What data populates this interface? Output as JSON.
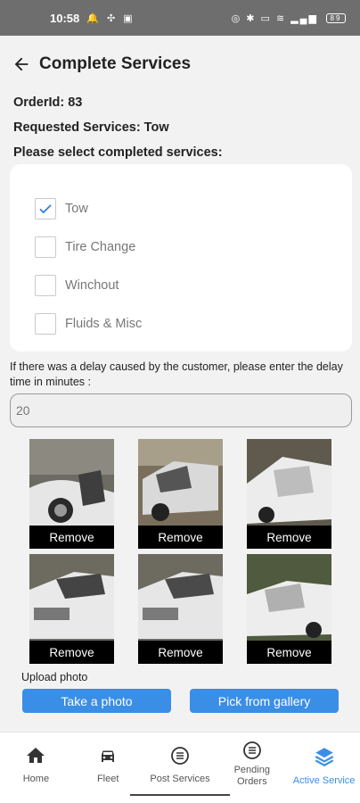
{
  "status_bar": {
    "time": "10:58",
    "battery": "89"
  },
  "header": {
    "title": "Complete Services"
  },
  "order": {
    "id_text": "OrderId: 83",
    "requested_text": "Requested Services: Tow",
    "prompt": "Please select completed services:"
  },
  "services": [
    {
      "label": "Tow",
      "checked": true
    },
    {
      "label": "Tire Change",
      "checked": false
    },
    {
      "label": "Winchout",
      "checked": false
    },
    {
      "label": "Fluids & Misc",
      "checked": false
    }
  ],
  "delay": {
    "label": "If there was a delay caused by the customer, please enter the delay time in minutes :",
    "value": "20"
  },
  "photos": {
    "remove_label": "Remove",
    "count": 6
  },
  "upload": {
    "label": "Upload photo",
    "take_photo": "Take a photo",
    "pick_gallery": "Pick from gallery"
  },
  "nav": {
    "home": "Home",
    "fleet": "Fleet",
    "post_services": "Post Services",
    "pending_orders": "Pending Orders",
    "active_service": "Active Service"
  },
  "colors": {
    "accent": "#3a8ee6",
    "status_bar": "#6e6e6e",
    "checkmark": "#2f7fd9"
  }
}
